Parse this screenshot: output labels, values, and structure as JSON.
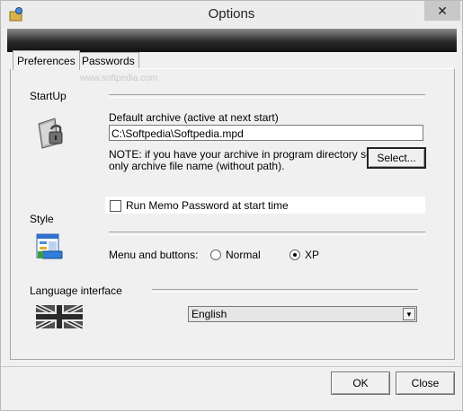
{
  "window": {
    "title": "Options",
    "close_glyph": "✕",
    "app_icon": "options-app-icon"
  },
  "tabs": [
    {
      "label": "Preferences",
      "active": true
    },
    {
      "label": "Passwords",
      "active": false
    }
  ],
  "watermark": "www.softpedia.com",
  "startup": {
    "section_label": "StartUp",
    "icon": "archive-lock-icon",
    "default_archive_label": "Default archive (active at next start)",
    "archive_path": "C:\\Softpedia\\Softpedia.mpd",
    "note_line1": "NOTE: if you have your archive in program directory set",
    "note_line2": "only archive file name (without path).",
    "select_label": "Select...",
    "run_memo_label": "Run Memo Password at start time",
    "run_memo_checked": false
  },
  "style": {
    "section_label": "Style",
    "icon": "window-style-icon",
    "menu_buttons_label": "Menu and  buttons:",
    "options": [
      {
        "label": "Normal",
        "selected": false
      },
      {
        "label": "XP",
        "selected": true
      }
    ]
  },
  "language": {
    "section_label": "Language interface",
    "icon": "uk-flag-icon",
    "selected": "English"
  },
  "footer": {
    "ok_label": "OK",
    "close_label": "Close"
  }
}
